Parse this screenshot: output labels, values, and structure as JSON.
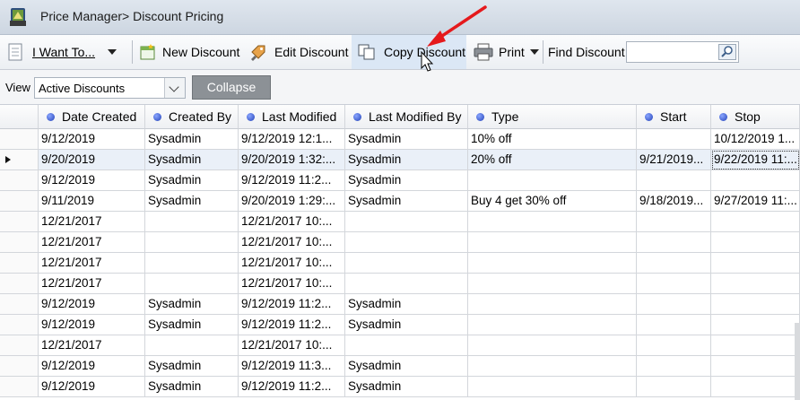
{
  "window": {
    "title": "Price Manager> Discount Pricing"
  },
  "toolbar": {
    "i_want_to": "I Want To...",
    "new_discount": "New Discount",
    "edit_discount": "Edit Discount",
    "copy_discount": "Copy Discount",
    "print": "Print",
    "find_label": "Find Discount",
    "find_value": ""
  },
  "view": {
    "label": "View",
    "selected": "Active Discounts",
    "collapse": "Collapse"
  },
  "grid": {
    "columns": [
      "Date Created",
      "Created By",
      "Last Modified",
      "Last Modified By",
      "Type",
      "Start",
      "Stop"
    ],
    "rows": [
      [
        "9/12/2019",
        "Sysadmin",
        "9/12/2019 12:1...",
        "Sysadmin",
        "10% off",
        "",
        "10/12/2019 1..."
      ],
      [
        "9/20/2019",
        "Sysadmin",
        "9/20/2019 1:32:...",
        "Sysadmin",
        "20% off",
        "9/21/2019...",
        "9/22/2019 11:..."
      ],
      [
        "9/12/2019",
        "Sysadmin",
        "9/12/2019 11:2...",
        "Sysadmin",
        "",
        "",
        ""
      ],
      [
        "9/11/2019",
        "Sysadmin",
        "9/20/2019 1:29:...",
        "Sysadmin",
        "Buy 4 get 30% off",
        "9/18/2019...",
        "9/27/2019 11:..."
      ],
      [
        "12/21/2017",
        "",
        "12/21/2017 10:...",
        "",
        "",
        "",
        ""
      ],
      [
        "12/21/2017",
        "",
        "12/21/2017 10:...",
        "",
        "",
        "",
        ""
      ],
      [
        "12/21/2017",
        "",
        "12/21/2017 10:...",
        "",
        "",
        "",
        ""
      ],
      [
        "12/21/2017",
        "",
        "12/21/2017 10:...",
        "",
        "",
        "",
        ""
      ],
      [
        "9/12/2019",
        "Sysadmin",
        "9/12/2019 11:2...",
        "Sysadmin",
        "",
        "",
        ""
      ],
      [
        "9/12/2019",
        "Sysadmin",
        "9/12/2019 11:2...",
        "Sysadmin",
        "",
        "",
        ""
      ],
      [
        "12/21/2017",
        "",
        "12/21/2017 10:...",
        "",
        "",
        "",
        ""
      ],
      [
        "9/12/2019",
        "Sysadmin",
        "9/12/2019 11:3...",
        "Sysadmin",
        "",
        "",
        ""
      ],
      [
        "9/12/2019",
        "Sysadmin",
        "9/12/2019 11:2...",
        "Sysadmin",
        "",
        "",
        ""
      ]
    ],
    "selected_row": 1
  },
  "icons": {
    "app": "price-manager-icon",
    "i_want_to": "document-list-icon",
    "new_discount": "new-discount-icon",
    "edit_discount": "edit-tag-icon",
    "copy_discount": "copy-icon",
    "print": "printer-icon",
    "find": "magnifier-icon"
  },
  "colors": {
    "annotation_arrow": "#e5191c",
    "header_dot": "#2342b8"
  }
}
